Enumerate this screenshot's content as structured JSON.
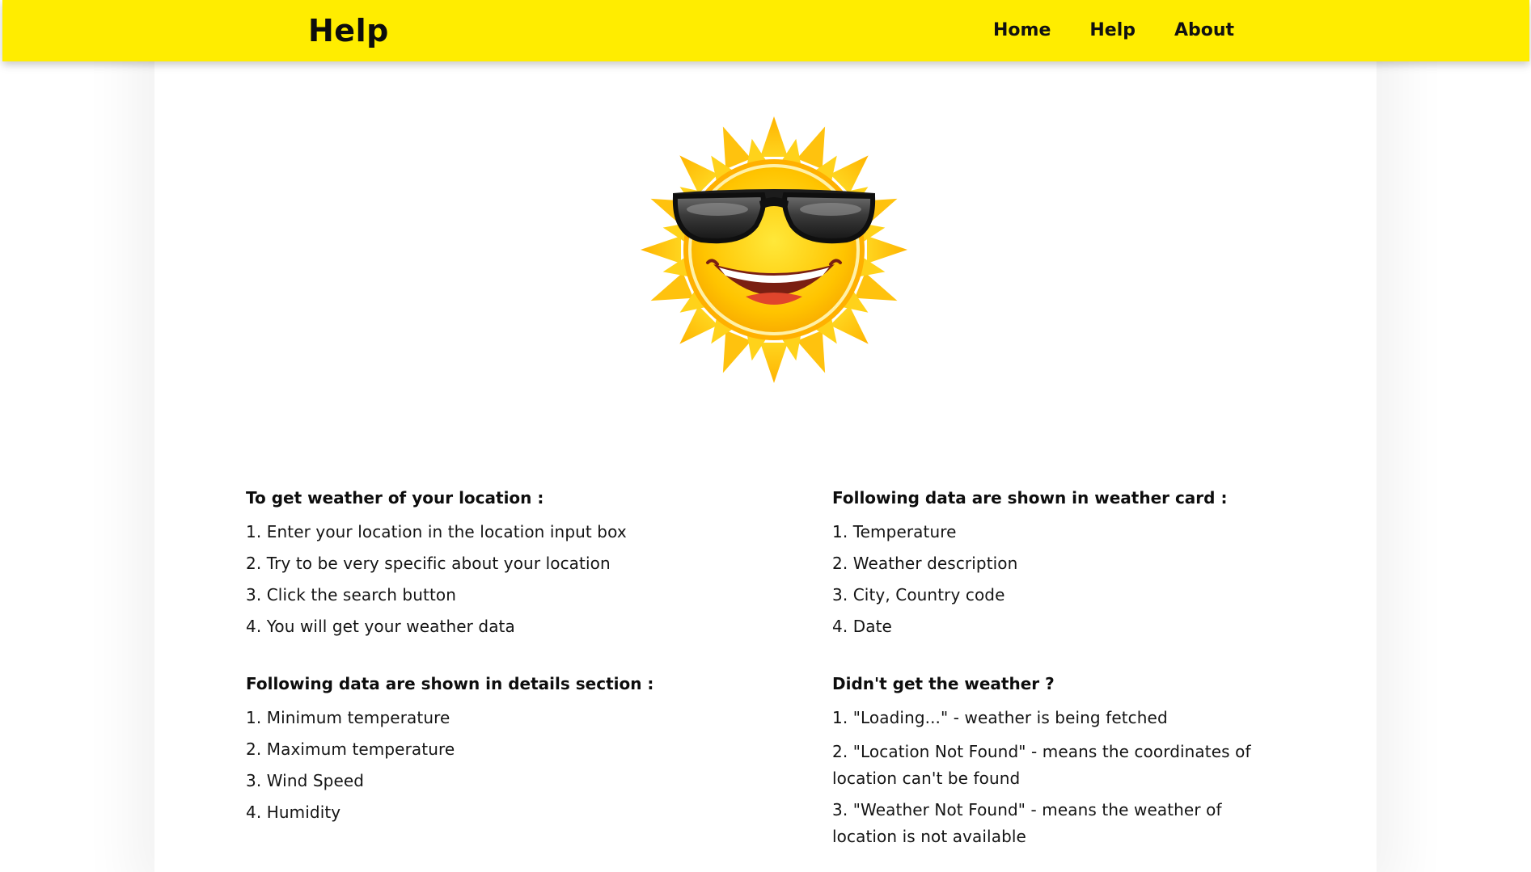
{
  "header": {
    "title": "Help",
    "nav": {
      "home": "Home",
      "help": "Help",
      "about": "About"
    },
    "background_color": "#ffed00"
  },
  "hero": {
    "icon": "sun-with-sunglasses-icon"
  },
  "sections": {
    "get_weather": {
      "title": "To get weather of your location :",
      "items": [
        "1. Enter your location in the location input box",
        "2. Try to be very specific about your location",
        "3. Click the search button",
        "4. You will get your weather data"
      ]
    },
    "weather_card": {
      "title": "Following data are shown in weather card :",
      "items": [
        "1. Temperature",
        "2. Weather description",
        "3. City, Country code",
        "4. Date"
      ]
    },
    "details": {
      "title": "Following data are shown in details section :",
      "items": [
        "1. Minimum temperature",
        "2. Maximum temperature",
        "3. Wind Speed",
        "4. Humidity"
      ]
    },
    "troubleshoot": {
      "title": "Didn't get the weather ?",
      "items": [
        "1. \"Loading...\" - weather is being fetched",
        "2. \"Location Not Found\" - means the coordinates of location can't be found",
        "3. \"Weather Not Found\" - means the weather of location is not available"
      ]
    }
  }
}
